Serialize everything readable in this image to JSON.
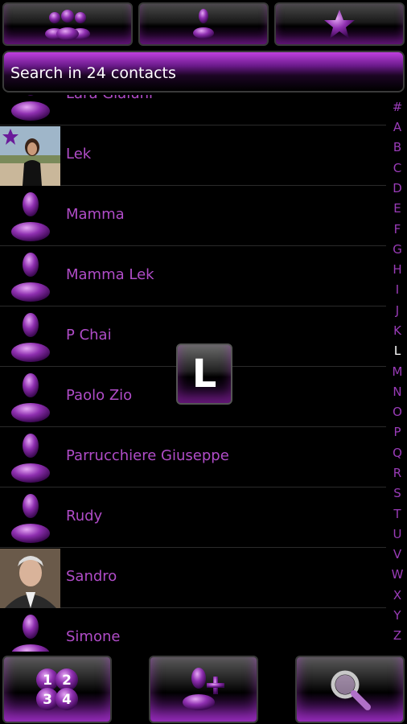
{
  "search": {
    "placeholder": "Search in 24 contacts"
  },
  "contacts": [
    {
      "name": "Lara Giaiuni",
      "avatar": "default"
    },
    {
      "name": "Lek",
      "avatar": "photo",
      "favorite": true
    },
    {
      "name": "Mamma",
      "avatar": "default"
    },
    {
      "name": "Mamma Lek",
      "avatar": "default"
    },
    {
      "name": "P Chai",
      "avatar": "default"
    },
    {
      "name": "Paolo Zio",
      "avatar": "default"
    },
    {
      "name": "Parrucchiere Giuseppe",
      "avatar": "default"
    },
    {
      "name": "Rudy",
      "avatar": "default"
    },
    {
      "name": "Sandro",
      "avatar": "photo"
    },
    {
      "name": "Simone",
      "avatar": "default"
    }
  ],
  "alphabet": [
    "#",
    "A",
    "B",
    "C",
    "D",
    "E",
    "F",
    "G",
    "H",
    "I",
    "J",
    "K",
    "L",
    "M",
    "N",
    "O",
    "P",
    "Q",
    "R",
    "S",
    "T",
    "U",
    "V",
    "W",
    "X",
    "Y",
    "Z"
  ],
  "active_letter": "L",
  "letter_overlay": "L",
  "icons": {
    "tab_groups": "group-icon",
    "tab_contacts": "person-icon",
    "tab_favorites": "star-icon",
    "dialer": "dialpad-1234-icon",
    "add_contact": "add-person-icon",
    "search": "magnifier-icon"
  },
  "colors": {
    "accent": "#b04cc8",
    "background": "#000000"
  }
}
